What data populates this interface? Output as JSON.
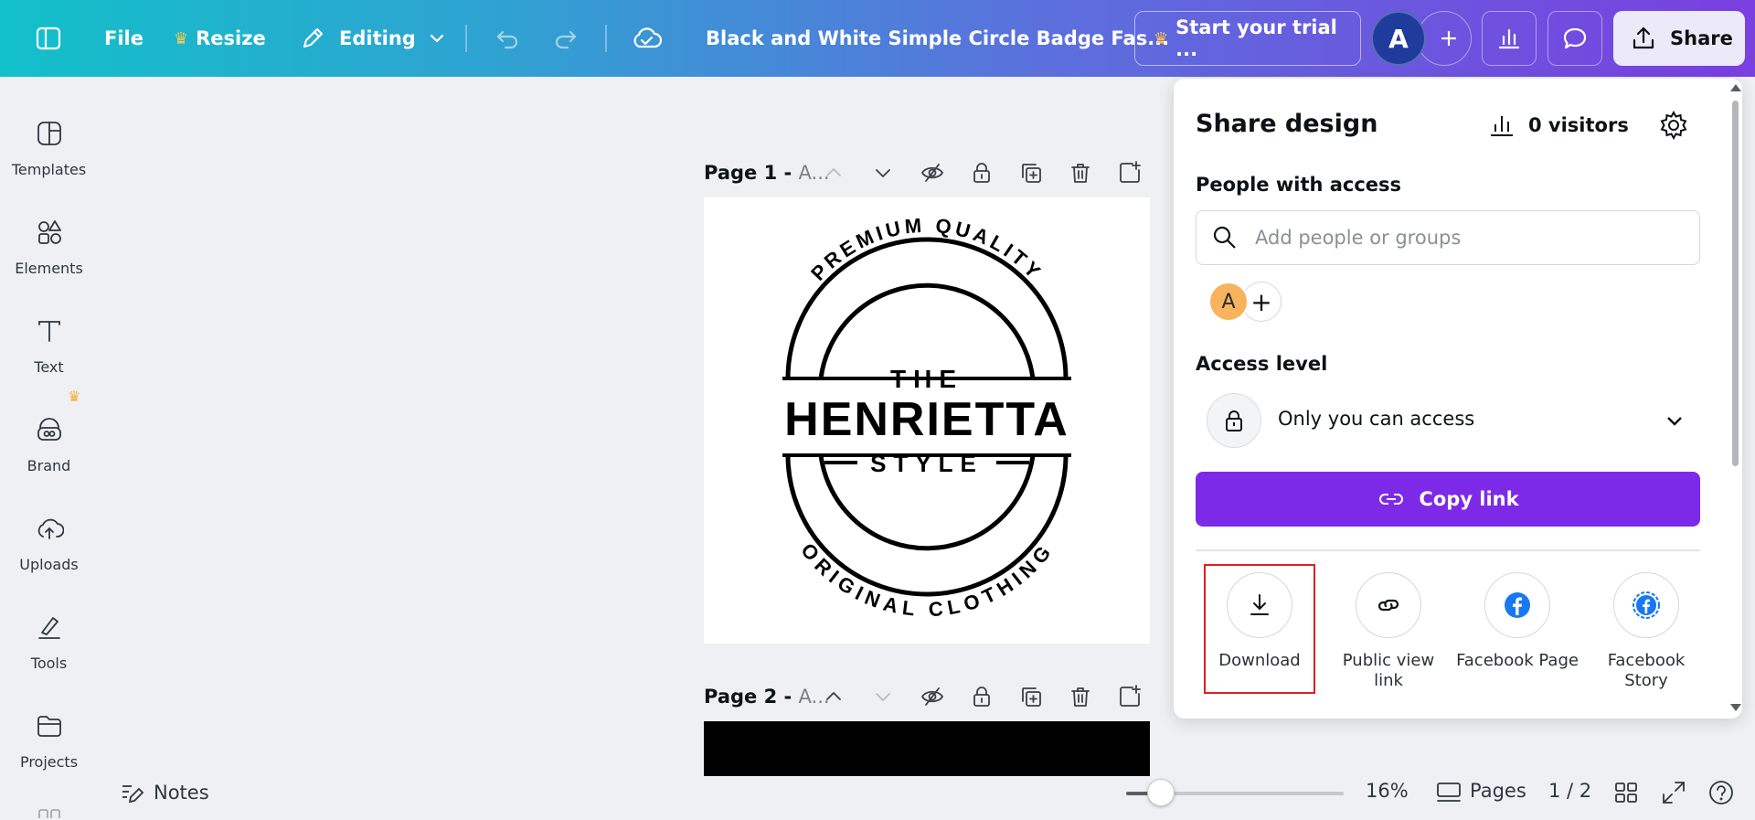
{
  "topbar": {
    "file_label": "File",
    "resize_label": "Resize",
    "editing_label": "Editing",
    "doc_title": "Black and White Simple Circle Badge Fas...",
    "trial_label": "Start your trial ...",
    "avatar_letter": "A",
    "share_label": "Share"
  },
  "sidebar": {
    "items": [
      {
        "label": "Templates",
        "icon": "templates-icon"
      },
      {
        "label": "Elements",
        "icon": "elements-icon"
      },
      {
        "label": "Text",
        "icon": "text-icon"
      },
      {
        "label": "Brand",
        "icon": "brand-icon"
      },
      {
        "label": "Uploads",
        "icon": "uploads-icon"
      },
      {
        "label": "Tools",
        "icon": "tools-icon"
      },
      {
        "label": "Projects",
        "icon": "projects-icon"
      }
    ]
  },
  "canvas": {
    "page1_title": "Page 1 - ",
    "page1_suffix": "A...",
    "page2_title": "Page 2 - ",
    "page2_suffix": "A...",
    "badge": {
      "top_arc": "PREMIUM QUALITY",
      "the": "THE",
      "name": "HENRIETTA",
      "style": "STYLE",
      "bottom_arc": "ORIGINAL CLOTHING"
    }
  },
  "bottombar": {
    "notes_label": "Notes",
    "zoom_label": "16%",
    "zoom_fraction": 0.16,
    "pages_label": "Pages",
    "page_count": "1 / 2"
  },
  "share_panel": {
    "title": "Share design",
    "visitors": "0 visitors",
    "people_label": "People with access",
    "search_placeholder": "Add people or groups",
    "member_letter": "A",
    "access_level_label": "Access level",
    "access_value": "Only you can access",
    "copy_link_label": "Copy link",
    "options": [
      {
        "label": "Download",
        "icon": "download-icon"
      },
      {
        "label": "Public view link",
        "icon": "link-icon"
      },
      {
        "label": "Facebook Page",
        "icon": "facebook-icon"
      },
      {
        "label": "Facebook Story",
        "icon": "facebook-story-icon"
      }
    ]
  },
  "colors": {
    "accent_purple": "#7d2ae8",
    "topbar_start": "#12c0c9",
    "topbar_end": "#7a3fe0",
    "highlight_red": "#e01f24",
    "facebook_blue": "#1877f2"
  }
}
